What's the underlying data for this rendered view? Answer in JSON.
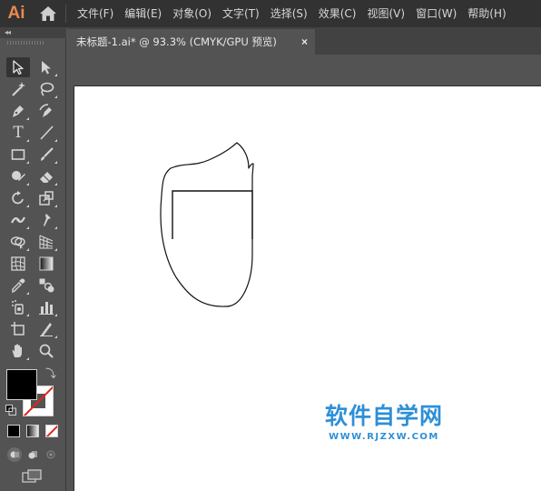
{
  "app": {
    "logo_text": "Ai",
    "brand_color": "#e78a4f"
  },
  "menu": {
    "items": [
      "文件(F)",
      "编辑(E)",
      "对象(O)",
      "文字(T)",
      "选择(S)",
      "效果(C)",
      "视图(V)",
      "窗口(W)",
      "帮助(H)"
    ]
  },
  "tools_panel": {
    "collapse_glyph": "◂◂",
    "type_glyph": "T",
    "tools": [
      "selection-tool",
      "direct-selection-tool",
      "magic-wand-tool",
      "lasso-tool",
      "pen-tool",
      "curvature-tool",
      "type-tool",
      "line-segment-tool",
      "rectangle-tool",
      "paintbrush-tool",
      "shaper-tool",
      "eraser-tool",
      "rotate-tool",
      "scale-tool",
      "width-tool",
      "puppet-warp-tool",
      "shape-builder-tool",
      "perspective-grid-tool",
      "mesh-tool",
      "gradient-tool",
      "eyedropper-tool",
      "blend-tool",
      "symbol-sprayer-tool",
      "column-graph-tool",
      "artboard-tool",
      "slice-tool",
      "hand-tool",
      "zoom-tool"
    ],
    "active_tool": "selection-tool",
    "fill_color": "#000000",
    "stroke_color": "none",
    "none_indicator_color": "#e0251c"
  },
  "document": {
    "tab_title": "未标题-1.ai* @ 93.3% (CMYK/GPU 预览)",
    "close_glyph": "×"
  },
  "watermark": {
    "title": "软件自学网",
    "url": "WWW.RJZXW.COM",
    "color": "#2e8fd8"
  }
}
